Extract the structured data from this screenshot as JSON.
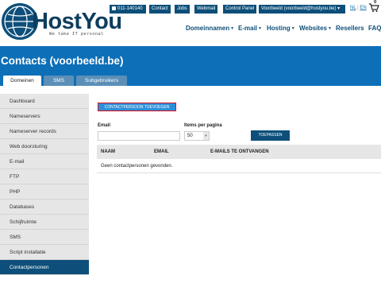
{
  "brand": {
    "name": "HostYou",
    "tagline": "We take IT personal"
  },
  "topbar": {
    "phone": "011-140140",
    "contact": "Contact",
    "jobs": "Jobs",
    "webmail": "Webmail",
    "control_panel": "Control Panel",
    "account": "Voorbeeld (voorbeeld@hostyou.be) ▾",
    "lang_nl": "NL",
    "lang_sep": "|",
    "lang_en": "EN",
    "cart_count": "0"
  },
  "nav": {
    "domains": "Domeinnamen",
    "email": "E-mail",
    "hosting": "Hosting",
    "websites": "Websites",
    "resellers": "Resellers",
    "faq": "FAQ"
  },
  "page": {
    "title": "Contacts (voorbeeld.be)"
  },
  "tabs": [
    "Domeinen",
    "SMS",
    "Subgebruikers"
  ],
  "sidebar": {
    "items": [
      "Dashboard",
      "Nameservers",
      "Nameserver records",
      "Web doorsturing",
      "E-mail",
      "FTP",
      "PHP",
      "Databases",
      "Schijfruimte",
      "SMS",
      "Script installatie",
      "Contactpersonen"
    ],
    "active": "Contactpersonen"
  },
  "main": {
    "add_button": "CONTACTPERSOON TOEVOEGEN",
    "email_label": "Email",
    "email_value": "",
    "per_page_label": "Items per pagina",
    "per_page_value": "50",
    "apply_button": "TOEPASSEN",
    "columns": [
      "NAAM",
      "EMAIL",
      "E-MAILS TE ONTVANGEN"
    ],
    "empty_message": "Geen contactpersonen gevonden."
  },
  "colors": {
    "brand_dark": "#0d4f7a",
    "hero": "#0d6fb8",
    "accent": "#2e8fd8",
    "highlight": "#e0101e"
  }
}
